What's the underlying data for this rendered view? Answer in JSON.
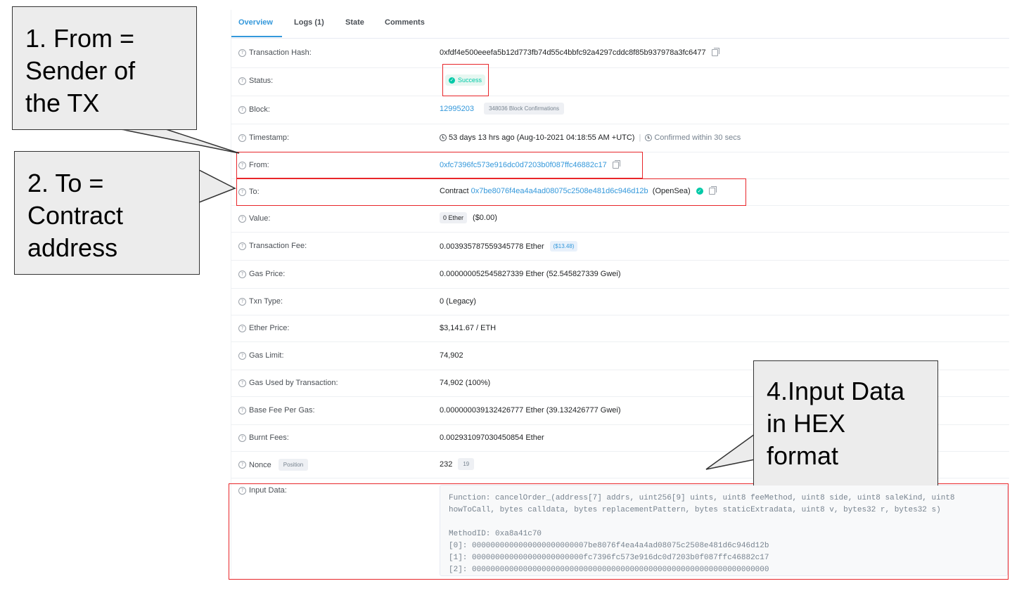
{
  "tabs": [
    {
      "label": "Overview",
      "active": true
    },
    {
      "label": "Logs (1)",
      "active": false
    },
    {
      "label": "State",
      "active": false
    },
    {
      "label": "Comments",
      "active": false
    }
  ],
  "fields": {
    "tx_hash": {
      "label": "Transaction Hash:",
      "value": "0xfdf4e500eeefa5b12d773fb74d55c4bbfc92a4297cddc8f85b937978a3fc6477"
    },
    "status": {
      "label": "Status:",
      "value": "Success"
    },
    "block": {
      "label": "Block:",
      "value": "12995203",
      "confirmations": "348036 Block Confirmations"
    },
    "timestamp": {
      "label": "Timestamp:",
      "value": "53 days 13 hrs ago (Aug-10-2021 04:18:55 AM +UTC)",
      "confirmed": "Confirmed within 30 secs"
    },
    "from": {
      "label": "From:",
      "value": "0xfc7396fc573e916dc0d7203b0f087ffc46882c17"
    },
    "to": {
      "label": "To:",
      "prefix": "Contract",
      "value": "0x7be8076f4ea4a4ad08075c2508e481d6c946d12b",
      "name": "(OpenSea)"
    },
    "value": {
      "label": "Value:",
      "amount": "0 Ether",
      "usd": "($0.00)"
    },
    "tx_fee": {
      "label": "Transaction Fee:",
      "value": "0.003935787559345778 Ether",
      "usd": "($13.48)"
    },
    "gas_price": {
      "label": "Gas Price:",
      "value": "0.000000052545827339 Ether (52.545827339 Gwei)"
    },
    "txn_type": {
      "label": "Txn Type:",
      "value": "0 (Legacy)"
    },
    "ether_price": {
      "label": "Ether Price:",
      "value": "$3,141.67 / ETH"
    },
    "gas_limit": {
      "label": "Gas Limit:",
      "value": "74,902"
    },
    "gas_used": {
      "label": "Gas Used by Transaction:",
      "value": "74,902 (100%)"
    },
    "base_fee": {
      "label": "Base Fee Per Gas:",
      "value": "0.000000039132426777 Ether (39.132426777 Gwei)"
    },
    "burnt_fees": {
      "label": "Burnt Fees:",
      "value": "0.002931097030450854 Ether"
    },
    "nonce": {
      "label": "Nonce",
      "position_label": "Position",
      "value": "232",
      "position": "19"
    },
    "input_data": {
      "label": "Input Data:",
      "lines": [
        "Function: cancelOrder_(address[7] addrs, uint256[9] uints, uint8 feeMethod, uint8 side, uint8 saleKind, uint8",
        "howToCall, bytes calldata, bytes replacementPattern, bytes staticExtradata, uint8 v, bytes32 r, bytes32 s)",
        "",
        "MethodID: 0xa8a41c70",
        "[0]:  0000000000000000000000007be8076f4ea4a4ad08075c2508e481d6c946d12b",
        "[1]:  000000000000000000000000fc7396fc573e916dc0d7203b0f087ffc46882c17",
        "[2]:  0000000000000000000000000000000000000000000000000000000000000000"
      ]
    }
  },
  "callouts": {
    "from": [
      "1. From =",
      "Sender of",
      "the TX"
    ],
    "to": [
      "2. To =",
      "Contract",
      "address"
    ],
    "input": [
      "4.Input Data",
      "in HEX",
      "format"
    ]
  },
  "colors": {
    "accent": "#3498db",
    "success": "#00c9a7",
    "highlight": "#e8262a"
  }
}
